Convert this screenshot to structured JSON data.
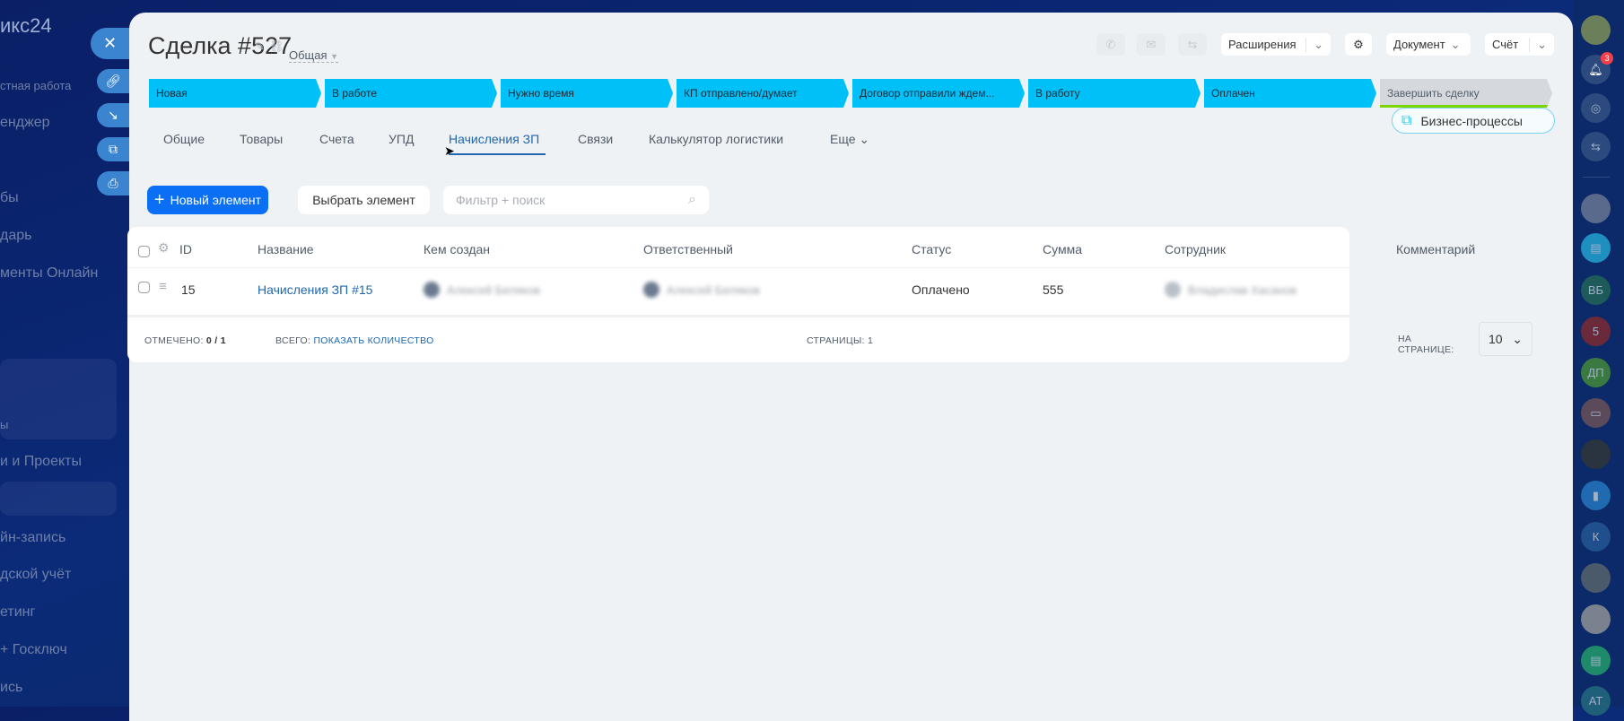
{
  "leftnav": {
    "logo": "икс24",
    "items": [
      "стная работа",
      "енджер",
      "бы",
      "дарь",
      "менты Онлайн",
      "ы",
      "и и Проекты",
      "йн-запись",
      "дской учёт",
      "етинг",
      "+ Госключ",
      "ись"
    ]
  },
  "header": {
    "title": "Сделка #527",
    "category": "Общая",
    "extensions": "Расширения",
    "document": "Документ",
    "invoice": "Счёт"
  },
  "stages": [
    "Новая",
    "В работе",
    "Нужно время",
    "КП отправлено/думает",
    "Договор отправили ждем...",
    "В работу",
    "Оплачен",
    "Завершить сделку"
  ],
  "tabs": [
    "Общие",
    "Товары",
    "Счета",
    "УПД",
    "Начисления ЗП",
    "Связи",
    "Калькулятор логистики",
    "Еще"
  ],
  "business_processes": "Бизнес-процессы",
  "toolbar": {
    "new": "Новый элемент",
    "select": "Выбрать элемент",
    "search_placeholder": "Фильтр + поиск"
  },
  "table": {
    "columns": [
      "ID",
      "Название",
      "Кем создан",
      "Ответственный",
      "Статус",
      "Сумма",
      "Сотрудник",
      "Комментарий"
    ],
    "rows": [
      {
        "id": "15",
        "name": "Начисления ЗП #15",
        "created_by": "Алексей Беляков",
        "responsible": "Алексей Беляков",
        "status": "Оплачено",
        "sum": "555",
        "employee": "Владислав Хасанов",
        "comment": ""
      }
    ]
  },
  "footer": {
    "checked_label": "ОТМЕЧЕНО:",
    "checked": "0 / 1",
    "total_label": "ВСЕГО:",
    "total_link": "ПОКАЗАТЬ КОЛИЧЕСТВО",
    "pages_label": "СТРАНИЦЫ:",
    "pages": "1",
    "per_page_label": "НА СТРАНИЦЕ:",
    "per_page": "10"
  },
  "rightbar": {
    "notifications": "3",
    "avatars": [
      "ВБ",
      "5",
      "ДП",
      "К",
      "АТ"
    ]
  }
}
